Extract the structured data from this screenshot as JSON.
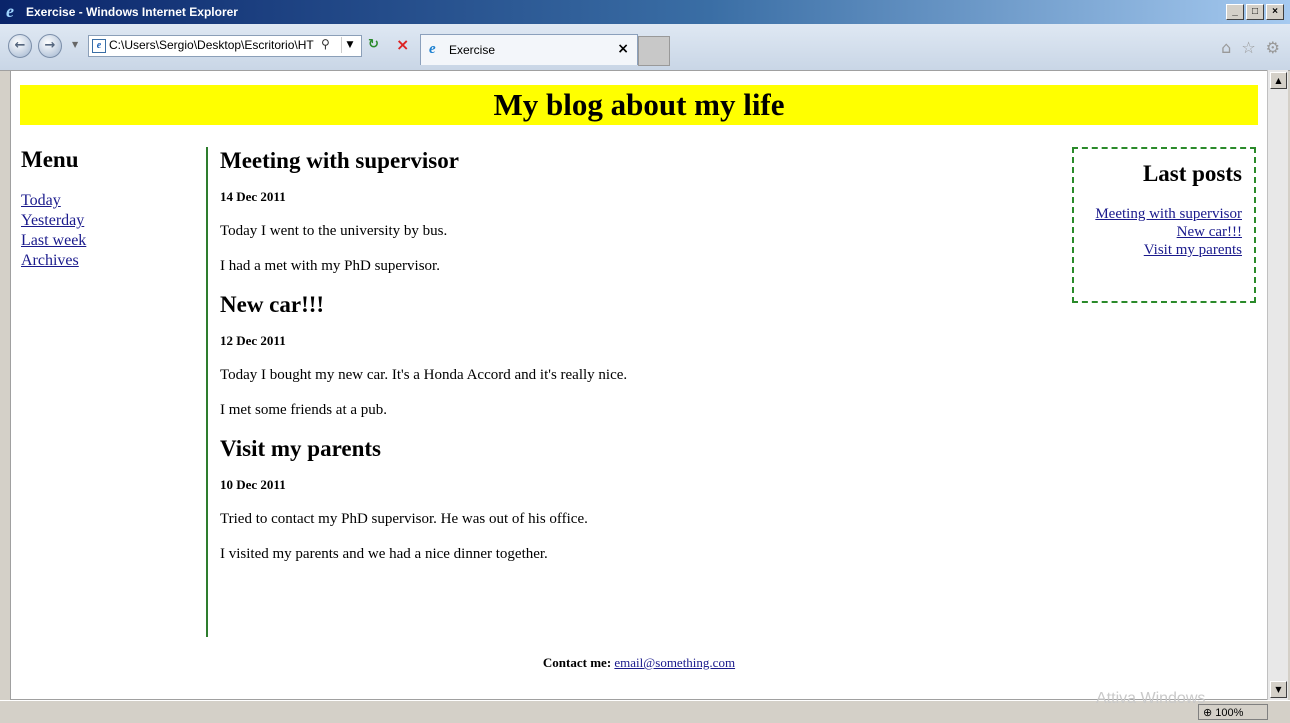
{
  "window": {
    "title": "Exercise - Windows Internet Explorer",
    "controls": {
      "minimize": "_",
      "maximize": "□",
      "close": "×"
    }
  },
  "toolbar": {
    "back": "←",
    "forward": "→",
    "nav_dropdown": "▼",
    "address": "C:\\Users\\Sergio\\Desktop\\Escritorio\\HT",
    "search_symbol": "⚲",
    "address_dropdown": "▼",
    "refresh": "↻",
    "stop": "×",
    "tab_label": "Exercise",
    "tab_close": "×",
    "home": "⌂",
    "favorites": "☆",
    "tools": "⚙"
  },
  "page": {
    "title": "My blog about my life",
    "menu": {
      "heading": "Menu",
      "items": [
        "Today",
        "Yesterday",
        "Last week",
        "Archives"
      ]
    },
    "posts": [
      {
        "title": "Meeting with supervisor",
        "date": "14 Dec 2011",
        "paragraphs": [
          "Today I went to the university by bus.",
          "I had a met with my PhD supervisor."
        ]
      },
      {
        "title": "New car!!!",
        "date": "12 Dec 2011",
        "paragraphs": [
          "Today I bought my new car. It's a Honda Accord and it's really nice.",
          "I met some friends at a pub."
        ]
      },
      {
        "title": "Visit my parents",
        "date": "10 Dec 2011",
        "paragraphs": [
          "Tried to contact my PhD supervisor. He was out of his office.",
          "I visited my parents and we had a nice dinner together."
        ]
      }
    ],
    "sidebar": {
      "heading": "Last posts",
      "links": [
        "Meeting with supervisor",
        "New car!!!",
        "Visit my parents"
      ]
    },
    "footer": {
      "label": "Contact me:",
      "email": "email@something.com"
    }
  },
  "statusbar": {
    "zoom": "100%",
    "watermark": "Attiva Windows"
  },
  "colors": {
    "header_bg": "#ffff00",
    "divider": "#2e7d2e",
    "sidebar_border": "#2a8a2a",
    "link": "#1a1a8c"
  }
}
